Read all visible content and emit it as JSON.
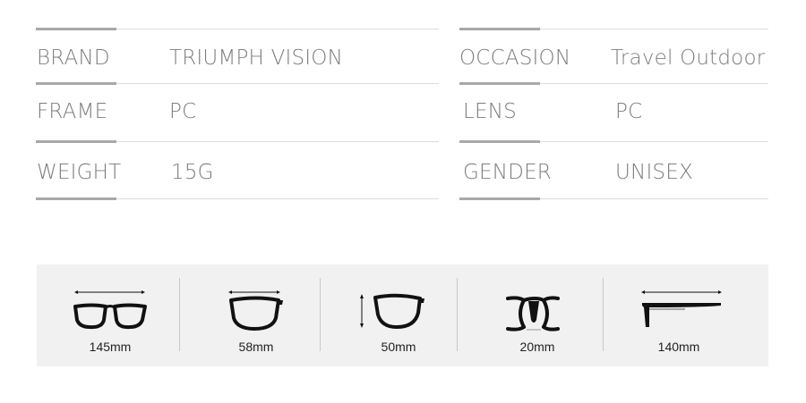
{
  "specs": {
    "brand_label": "BRAND",
    "brand_value": "TRIUMPH VISION",
    "occasion_label": "OCCASION",
    "occasion_value": "Travel Outdoor",
    "frame_label": "FRAME",
    "frame_value": "PC",
    "lens_label": "LENS",
    "lens_value": "PC",
    "weight_label": "WEIGHT",
    "weight_value": "15G",
    "gender_label": "GENDER",
    "gender_value": "UNISEX"
  },
  "measurements": [
    {
      "value": "145mm",
      "icon": "frame-width-icon"
    },
    {
      "value": "58mm",
      "icon": "lens-width-icon"
    },
    {
      "value": "50mm",
      "icon": "lens-height-icon"
    },
    {
      "value": "20mm",
      "icon": "bridge-width-icon"
    },
    {
      "value": "140mm",
      "icon": "temple-length-icon"
    }
  ],
  "colors": {
    "text": "#7d7d7d",
    "accent": "#a8a8a8",
    "panel": "#f1f1f1",
    "icon": "#111111"
  }
}
